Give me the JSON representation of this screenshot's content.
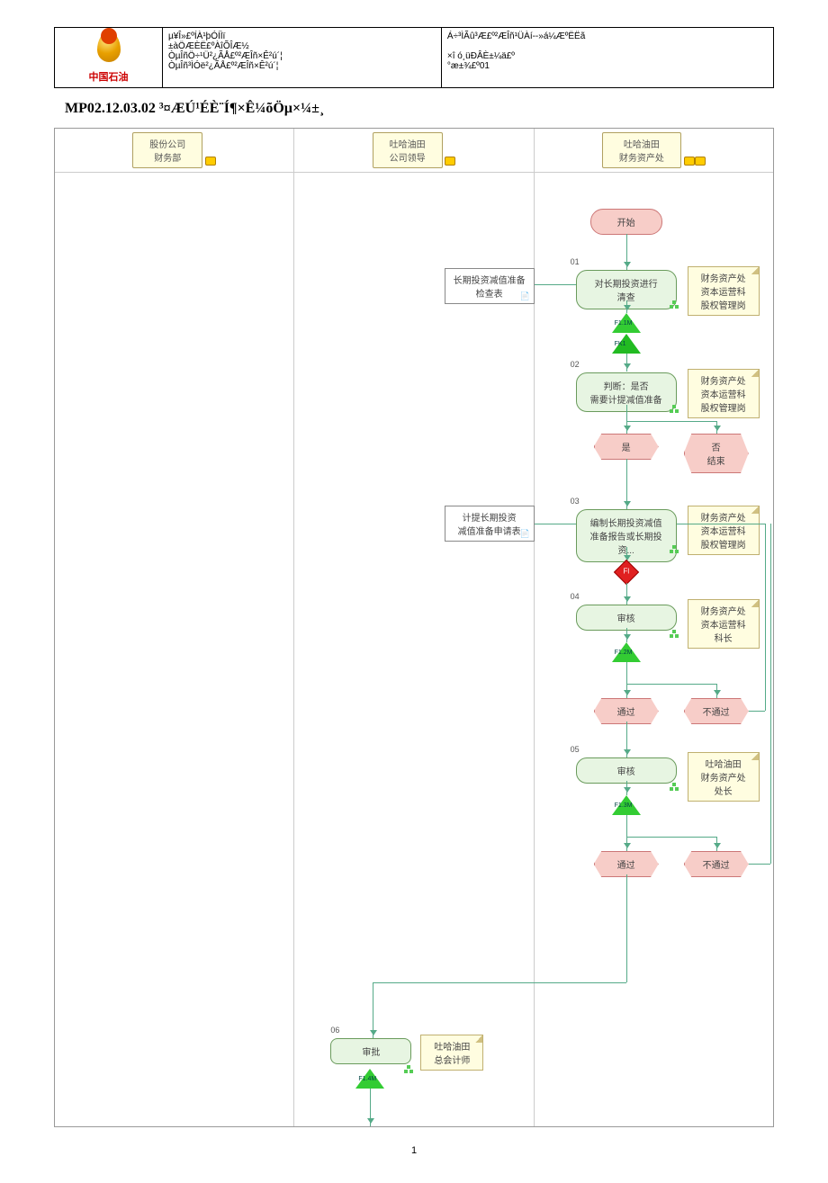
{
  "header": {
    "logoText": "中国石油",
    "c1l1": "µ¥Î»£ºÍÀ¹þÓÍÌï",
    "c1l2": "±àÖÆÈË£ºÀîÕÎÆ½",
    "c1l3": "ÒµÎñÖ÷¹Ü²¿ÃÅ£º²ÆÎñ×Ê²ú´¦",
    "c1l4": "ÒµÎñ³ÌÓë²¿ÃÅ£º²ÆÎñ×Ê²ú´¦",
    "c2l1": "Á÷³ÌÃû³Æ£º²ÆÎñ¹ÜÀí--»á¼ÆºËËã",
    "c2l2": "×î ó¸üÐÂÈ±¼ä£º",
    "c2l3": "°æ±¾£º01"
  },
  "title": "MP02.12.03.02 ³¤ÆÚ¹ÉÈ¨Í¶×Ê¼õÖµ×¼±¸",
  "lanes": {
    "l1": "股份公司\n财务部",
    "l2": "吐哈油田\n公司领导",
    "l3": "吐哈油田\n财务资产处"
  },
  "nodes": {
    "start": "开始",
    "n01": "对长期投资进行\n清查",
    "n01role": "财务资产处\n资本运营科\n股权管理岗",
    "n01doc": "长期投资减值准备\n检查表",
    "n02": "判断：是否\n需要计提减值准备",
    "n02role": "财务资产处\n资本运营科\n股权管理岗",
    "yes": "是",
    "noEnd": "否\n结束",
    "n03": "编制长期投资减值\n准备报告或长期投\n资...",
    "n03role": "财务资产处\n资本运营科\n股权管理岗",
    "n03doc": "计提长期投资\n减值准备申请表",
    "n04": "审核",
    "n04role": "财务资产处\n资本运营科\n科长",
    "pass": "通过",
    "nopass": "不通过",
    "n05": "审核",
    "n05role": "吐哈油田\n财务资产处\n处长",
    "n06": "审批",
    "n06role": "吐哈油田\n总会计师"
  },
  "marks": {
    "t1": "F1.1M",
    "fk1": "FK1",
    "fl": "Fl",
    "t2": "F1.2M",
    "t3": "F1.3M",
    "t4": "F1.4M"
  },
  "nums": {
    "n1": "01",
    "n2": "02",
    "n3": "03",
    "n4": "04",
    "n5": "05",
    "n6": "06"
  },
  "pageNumber": "1"
}
